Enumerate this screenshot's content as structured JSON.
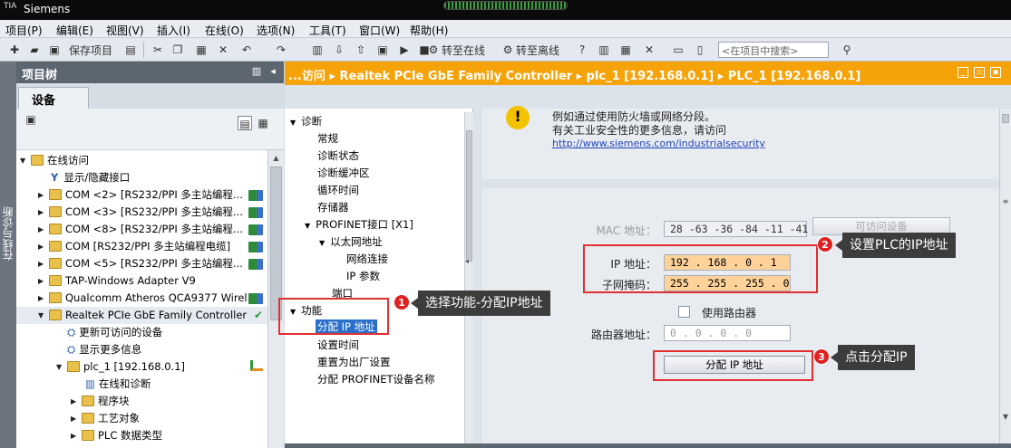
{
  "titlebar": {
    "logo": "TIA",
    "title": "Siemens"
  },
  "menu": [
    {
      "label": "项目(P)"
    },
    {
      "label": "编辑(E)"
    },
    {
      "label": "视图(V)"
    },
    {
      "label": "插入(I)"
    },
    {
      "label": "在线(O)"
    },
    {
      "label": "选项(N)"
    },
    {
      "label": "工具(T)"
    },
    {
      "label": "窗口(W)"
    },
    {
      "label": "帮助(H)"
    }
  ],
  "toolbar": {
    "save_project": "保存项目",
    "go_online": "转至在线",
    "go_offline": "转至离线",
    "search_placeholder": "<在项目中搜索>"
  },
  "sidestrip": {
    "label": "在线与诊断"
  },
  "project_tree": {
    "header": "项目树",
    "tab": "设备",
    "items": [
      {
        "label": "在线访问"
      },
      {
        "label": "显示/隐藏接口"
      },
      {
        "label": "COM <2> [RS232/PPI 多主站编程..."
      },
      {
        "label": "COM <3> [RS232/PPI 多主站编程..."
      },
      {
        "label": "COM <8> [RS232/PPI 多主站编程..."
      },
      {
        "label": "COM [RS232/PPI 多主站编程电缆]"
      },
      {
        "label": "COM <5> [RS232/PPI 多主站编程..."
      },
      {
        "label": "TAP-Windows Adapter V9"
      },
      {
        "label": "Qualcomm Atheros QCA9377 Wirel..."
      },
      {
        "label": "Realtek PCIe GbE Family Controller"
      },
      {
        "label": "更新可访问的设备"
      },
      {
        "label": "显示更多信息"
      },
      {
        "label": "plc_1 [192.168.0.1]"
      },
      {
        "label": "在线和诊断"
      },
      {
        "label": "程序块"
      },
      {
        "label": "工艺对象"
      },
      {
        "label": "PLC 数据类型"
      }
    ]
  },
  "breadcrumb": {
    "text": "...访问 ▸ Realtek PCIe GbE Family Controller ▸ plc_1 [192.168.0.1] ▸ PLC_1 [192.168.0.1]"
  },
  "nav": {
    "diagnostics": "诊断",
    "general": "常规",
    "diag_status": "诊断状态",
    "diag_buffer": "诊断缓冲区",
    "cycle_time": "循环时间",
    "memory": "存储器",
    "profinet": "PROFINET接口 [X1]",
    "ethernet": "以太网地址",
    "net_conn": "网络连接",
    "ip_params": "IP 参数",
    "port": "端口",
    "functions": "功能",
    "assign_ip": "分配 IP 地址",
    "set_time": "设置时间",
    "reset_factory": "重置为出厂设置",
    "assign_name": "分配 PROFINET设备名称"
  },
  "security": {
    "line1": "例如通过使用防火墙或网络分段。",
    "line2": "有关工业安全性的更多信息，请访问",
    "link": "http://www.siemens.com/industrialsecurity"
  },
  "form": {
    "mac_label": "MAC 地址：",
    "mac_value": "28 -63 -36 -84 -11 -41",
    "accessible_btn": "可访问设备",
    "ip_label": "IP 地址：",
    "ip_value": "192 . 168 . 0    . 1",
    "subnet_label": "子网掩码：",
    "subnet_value": "255 . 255 . 255 . 0",
    "use_router": "使用路由器",
    "router_label": "路由器地址：",
    "router_value": "0    . 0    . 0    . 0",
    "assign_btn": "分配 IP 地址"
  },
  "annotations": {
    "c1_num": "1",
    "c1_text": "选择功能-分配IP地址",
    "c2_num": "2",
    "c2_text": "设置PLC的IP地址",
    "c3_num": "3",
    "c3_text": "点击分配IP"
  },
  "colors": {
    "accent": "#f6a30a",
    "annotation": "#e03030",
    "highlight_field": "#ffd29a"
  }
}
